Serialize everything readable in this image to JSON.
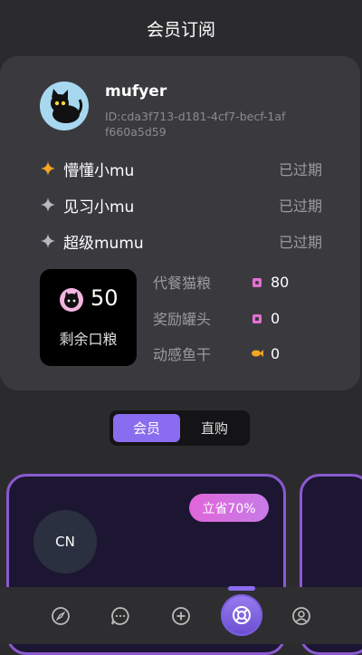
{
  "header": {
    "title": "会员订阅"
  },
  "user": {
    "name": "mufyer",
    "id": "ID:cda3f713-d181-4cf7-becf-1aff660a5d59"
  },
  "tiers": [
    {
      "name": "懵懂小mu",
      "status": "已过期",
      "icon": "star-orange-icon"
    },
    {
      "name": "见习小mu",
      "status": "已过期",
      "icon": "star-gray-icon"
    },
    {
      "name": "超级mumu",
      "status": "已过期",
      "icon": "star-gray-icon"
    }
  ],
  "rations": {
    "count": "50",
    "label": "剩余口粮"
  },
  "stats": [
    {
      "label": "代餐猫粮",
      "value": "80",
      "icon": "cat-food-icon"
    },
    {
      "label": "奖励罐头",
      "value": "0",
      "icon": "can-icon"
    },
    {
      "label": "动感鱼干",
      "value": "0",
      "icon": "fish-icon"
    }
  ],
  "segment": {
    "member": "会员",
    "direct": "直购"
  },
  "plan": {
    "badge": "立省70%",
    "avatar_text": "CN"
  },
  "colors": {
    "accent": "#8a6cf0",
    "badge": "#e066d8",
    "orange": "#f5a623"
  }
}
